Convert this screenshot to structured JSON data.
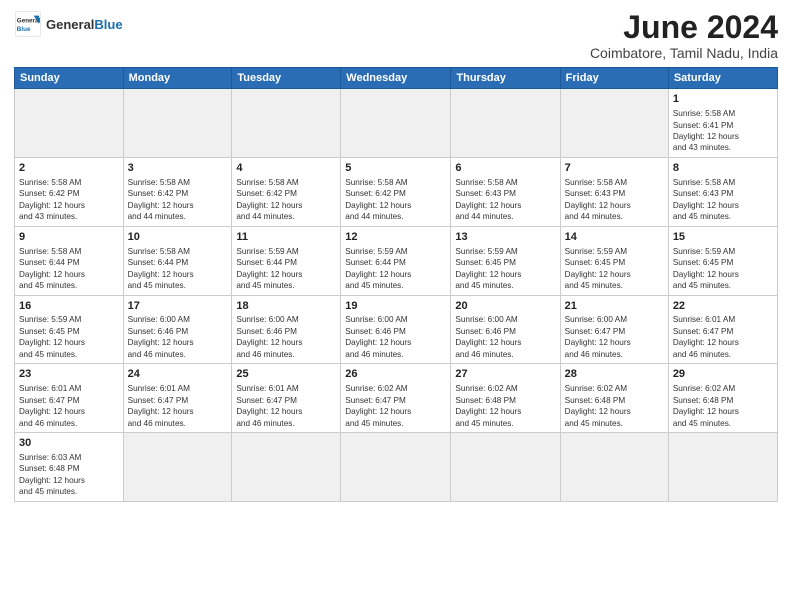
{
  "header": {
    "logo_general": "General",
    "logo_blue": "Blue",
    "month_title": "June 2024",
    "location": "Coimbatore, Tamil Nadu, India"
  },
  "days_of_week": [
    "Sunday",
    "Monday",
    "Tuesday",
    "Wednesday",
    "Thursday",
    "Friday",
    "Saturday"
  ],
  "weeks": [
    [
      {
        "day": "",
        "info": ""
      },
      {
        "day": "",
        "info": ""
      },
      {
        "day": "",
        "info": ""
      },
      {
        "day": "",
        "info": ""
      },
      {
        "day": "",
        "info": ""
      },
      {
        "day": "",
        "info": ""
      },
      {
        "day": "1",
        "info": "Sunrise: 5:58 AM\nSunset: 6:41 PM\nDaylight: 12 hours\nand 43 minutes."
      }
    ],
    [
      {
        "day": "2",
        "info": "Sunrise: 5:58 AM\nSunset: 6:42 PM\nDaylight: 12 hours\nand 43 minutes."
      },
      {
        "day": "3",
        "info": "Sunrise: 5:58 AM\nSunset: 6:42 PM\nDaylight: 12 hours\nand 44 minutes."
      },
      {
        "day": "4",
        "info": "Sunrise: 5:58 AM\nSunset: 6:42 PM\nDaylight: 12 hours\nand 44 minutes."
      },
      {
        "day": "5",
        "info": "Sunrise: 5:58 AM\nSunset: 6:42 PM\nDaylight: 12 hours\nand 44 minutes."
      },
      {
        "day": "6",
        "info": "Sunrise: 5:58 AM\nSunset: 6:43 PM\nDaylight: 12 hours\nand 44 minutes."
      },
      {
        "day": "7",
        "info": "Sunrise: 5:58 AM\nSunset: 6:43 PM\nDaylight: 12 hours\nand 44 minutes."
      },
      {
        "day": "8",
        "info": "Sunrise: 5:58 AM\nSunset: 6:43 PM\nDaylight: 12 hours\nand 45 minutes."
      }
    ],
    [
      {
        "day": "9",
        "info": "Sunrise: 5:58 AM\nSunset: 6:44 PM\nDaylight: 12 hours\nand 45 minutes."
      },
      {
        "day": "10",
        "info": "Sunrise: 5:58 AM\nSunset: 6:44 PM\nDaylight: 12 hours\nand 45 minutes."
      },
      {
        "day": "11",
        "info": "Sunrise: 5:59 AM\nSunset: 6:44 PM\nDaylight: 12 hours\nand 45 minutes."
      },
      {
        "day": "12",
        "info": "Sunrise: 5:59 AM\nSunset: 6:44 PM\nDaylight: 12 hours\nand 45 minutes."
      },
      {
        "day": "13",
        "info": "Sunrise: 5:59 AM\nSunset: 6:45 PM\nDaylight: 12 hours\nand 45 minutes."
      },
      {
        "day": "14",
        "info": "Sunrise: 5:59 AM\nSunset: 6:45 PM\nDaylight: 12 hours\nand 45 minutes."
      },
      {
        "day": "15",
        "info": "Sunrise: 5:59 AM\nSunset: 6:45 PM\nDaylight: 12 hours\nand 45 minutes."
      }
    ],
    [
      {
        "day": "16",
        "info": "Sunrise: 5:59 AM\nSunset: 6:45 PM\nDaylight: 12 hours\nand 45 minutes."
      },
      {
        "day": "17",
        "info": "Sunrise: 6:00 AM\nSunset: 6:46 PM\nDaylight: 12 hours\nand 46 minutes."
      },
      {
        "day": "18",
        "info": "Sunrise: 6:00 AM\nSunset: 6:46 PM\nDaylight: 12 hours\nand 46 minutes."
      },
      {
        "day": "19",
        "info": "Sunrise: 6:00 AM\nSunset: 6:46 PM\nDaylight: 12 hours\nand 46 minutes."
      },
      {
        "day": "20",
        "info": "Sunrise: 6:00 AM\nSunset: 6:46 PM\nDaylight: 12 hours\nand 46 minutes."
      },
      {
        "day": "21",
        "info": "Sunrise: 6:00 AM\nSunset: 6:47 PM\nDaylight: 12 hours\nand 46 minutes."
      },
      {
        "day": "22",
        "info": "Sunrise: 6:01 AM\nSunset: 6:47 PM\nDaylight: 12 hours\nand 46 minutes."
      }
    ],
    [
      {
        "day": "23",
        "info": "Sunrise: 6:01 AM\nSunset: 6:47 PM\nDaylight: 12 hours\nand 46 minutes."
      },
      {
        "day": "24",
        "info": "Sunrise: 6:01 AM\nSunset: 6:47 PM\nDaylight: 12 hours\nand 46 minutes."
      },
      {
        "day": "25",
        "info": "Sunrise: 6:01 AM\nSunset: 6:47 PM\nDaylight: 12 hours\nand 46 minutes."
      },
      {
        "day": "26",
        "info": "Sunrise: 6:02 AM\nSunset: 6:47 PM\nDaylight: 12 hours\nand 45 minutes."
      },
      {
        "day": "27",
        "info": "Sunrise: 6:02 AM\nSunset: 6:48 PM\nDaylight: 12 hours\nand 45 minutes."
      },
      {
        "day": "28",
        "info": "Sunrise: 6:02 AM\nSunset: 6:48 PM\nDaylight: 12 hours\nand 45 minutes."
      },
      {
        "day": "29",
        "info": "Sunrise: 6:02 AM\nSunset: 6:48 PM\nDaylight: 12 hours\nand 45 minutes."
      }
    ],
    [
      {
        "day": "30",
        "info": "Sunrise: 6:03 AM\nSunset: 6:48 PM\nDaylight: 12 hours\nand 45 minutes."
      },
      {
        "day": "",
        "info": ""
      },
      {
        "day": "",
        "info": ""
      },
      {
        "day": "",
        "info": ""
      },
      {
        "day": "",
        "info": ""
      },
      {
        "day": "",
        "info": ""
      },
      {
        "day": "",
        "info": ""
      }
    ]
  ]
}
